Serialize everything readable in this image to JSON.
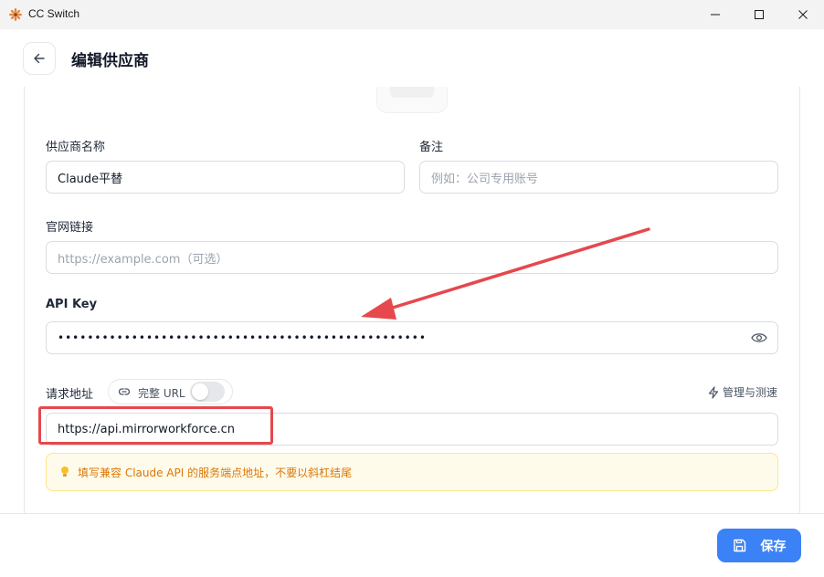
{
  "window": {
    "title": "CC Switch",
    "icon": "sunflower-icon",
    "controls": [
      "minimize-icon",
      "maximize-icon",
      "close-icon"
    ]
  },
  "header": {
    "back_icon": "arrow-left-icon",
    "title": "编辑供应商"
  },
  "form": {
    "provider_name": {
      "label": "供应商名称",
      "value": "Claude平替"
    },
    "notes": {
      "label": "备注",
      "placeholder": "例如：公司专用账号"
    },
    "website": {
      "label": "官网链接",
      "placeholder": "https://example.com（可选）"
    },
    "api_key": {
      "label": "API Key",
      "value": "••••••••••••••••••••••••••••••••••••••••••••••••••",
      "toggle_icon": "eye-icon"
    },
    "endpoint": {
      "label": "请求地址",
      "full_url_label": "完整 URL",
      "full_url_enabled": false,
      "manage_label": "管理与测速",
      "value": "https://api.mirrorworkforce.cn",
      "hint": "填写兼容 Claude API 的服务端点地址，不要以斜杠结尾"
    }
  },
  "footer": {
    "save_label": "保存",
    "save_icon": "save-icon"
  },
  "colors": {
    "accent": "#3b82f6",
    "annotation": "#e5484d",
    "hint_text": "#d97706",
    "hint_bg": "#fffbeb"
  }
}
